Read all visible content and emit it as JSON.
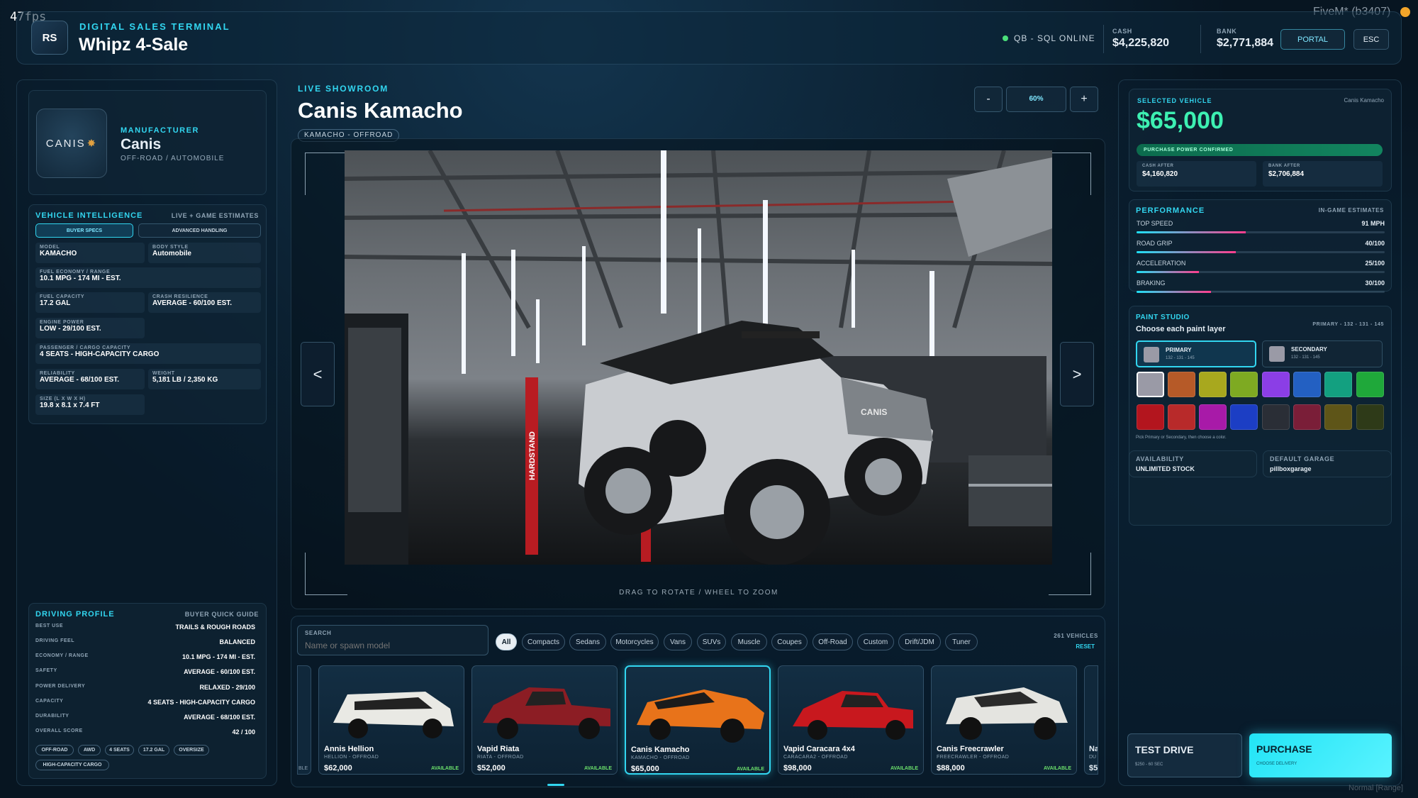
{
  "overlay": {
    "fps": "47fps",
    "fivem": "FiveM* (b3407)",
    "corner": "Normal [Range]"
  },
  "header": {
    "logo": "RS",
    "subtitle": "DIGITAL SALES TERMINAL",
    "title": "Whipz 4-Sale",
    "status": "QB - SQL ONLINE",
    "cash_label": "CASH",
    "cash": "$4,225,820",
    "bank_label": "BANK",
    "bank": "$2,771,884",
    "portal": "PORTAL",
    "esc": "ESC"
  },
  "manufacturer": {
    "logo_text": "CANIS",
    "label": "MANUFACTURER",
    "name": "Canis",
    "category": "OFF-ROAD / AUTOMOBILE"
  },
  "intel": {
    "title": "VEHICLE INTELLIGENCE",
    "hint": "LIVE + GAME ESTIMATES",
    "tab_buyer": "BUYER SPECS",
    "tab_handling": "ADVANCED HANDLING",
    "model_label": "MODEL",
    "model": "KAMACHO",
    "body_label": "BODY STYLE",
    "body": "Automobile",
    "fuel_label": "FUEL ECONOMY / RANGE",
    "fuel": "10.1 MPG - 174 MI - EST.",
    "capacity_label": "FUEL CAPACITY",
    "capacity": "17.2 GAL",
    "crash_label": "CRASH RESILIENCE",
    "crash": "AVERAGE - 60/100 EST.",
    "power_label": "ENGINE POWER",
    "power": "LOW - 29/100 EST.",
    "pass_label": "PASSENGER / CARGO CAPACITY",
    "pass": "4 SEATS - HIGH-CAPACITY CARGO",
    "rel_label": "RELIABILITY",
    "rel": "AVERAGE - 68/100 EST.",
    "weight_label": "WEIGHT",
    "weight": "5,181 LB / 2,350 KG",
    "size_label": "SIZE (L x W x H)",
    "size": "19.8 x 8.1 x 7.4 FT"
  },
  "profile": {
    "title": "DRIVING PROFILE",
    "hint": "BUYER QUICK GUIDE",
    "rows": [
      {
        "k": "BEST USE",
        "v": "TRAILS & ROUGH ROADS"
      },
      {
        "k": "DRIVING FEEL",
        "v": "BALANCED"
      },
      {
        "k": "ECONOMY / RANGE",
        "v": "10.1 MPG - 174 MI - EST."
      },
      {
        "k": "SAFETY",
        "v": "AVERAGE - 60/100 EST."
      },
      {
        "k": "POWER DELIVERY",
        "v": "RELAXED - 29/100"
      },
      {
        "k": "CAPACITY",
        "v": "4 SEATS - HIGH-CAPACITY CARGO"
      },
      {
        "k": "DURABILITY",
        "v": "AVERAGE - 68/100 EST."
      },
      {
        "k": "OVERALL SCORE",
        "v": "42 / 100"
      }
    ],
    "tags": [
      "OFF-ROAD",
      "AWD",
      "4 SEATS",
      "17.2 GAL",
      "OVERSIZE",
      "HIGH-CAPACITY CARGO"
    ]
  },
  "showroom": {
    "label": "LIVE SHOWROOM",
    "title": "Canis Kamacho",
    "badge": "KAMACHO - OFFROAD",
    "zoom_minus": "-",
    "zoom": "60%",
    "zoom_plus": "+",
    "hint": "DRAG TO ROTATE / WHEEL TO ZOOM",
    "prev": "<",
    "next": ">",
    "scene_sign": "CANIS",
    "lift_text": "HARDSTAND"
  },
  "search": {
    "label": "SEARCH",
    "placeholder": "Name or spawn model",
    "count": "261 VEHICLES",
    "reset": "RESET",
    "filters": [
      "All",
      "Compacts",
      "Sedans",
      "Motorcycles",
      "Vans",
      "SUVs",
      "Muscle",
      "Coupes",
      "Off-Road",
      "Custom",
      "Drift/JDM",
      "Tuner"
    ]
  },
  "cards": [
    {
      "name": "Annis Hellion",
      "sub": "HELLION - OFFROAD",
      "price": "$62,000",
      "avail": "AVAILABLE",
      "color": "#e9e9e4"
    },
    {
      "name": "Vapid Riata",
      "sub": "RIATA - OFFROAD",
      "price": "$52,000",
      "avail": "AVAILABLE",
      "color": "#8c1d24"
    },
    {
      "name": "Canis Kamacho",
      "sub": "KAMACHO - OFFROAD",
      "price": "$65,000",
      "avail": "AVAILABLE",
      "color": "#e8731a"
    },
    {
      "name": "Vapid Caracara 4x4",
      "sub": "CARACARA2 - OFFROAD",
      "price": "$98,000",
      "avail": "AVAILABLE",
      "color": "#c8181e"
    },
    {
      "name": "Canis Freecrawler",
      "sub": "FREECRAWLER - OFFROAD",
      "price": "$88,000",
      "avail": "AVAILABLE",
      "color": "#e4e4e0"
    }
  ],
  "card_edges": {
    "left_sub": "BLE",
    "right_name": "Na",
    "right_sub": "DU",
    "right_price": "$5"
  },
  "selected": {
    "label": "SELECTED VEHICLE",
    "name": "Canis Kamacho",
    "price": "$65,000",
    "power": "PURCHASE POWER CONFIRMED",
    "cash_after_label": "CASH AFTER",
    "cash_after": "$4,160,820",
    "bank_after_label": "BANK AFTER",
    "bank_after": "$2,706,884"
  },
  "performance": {
    "title": "PERFORMANCE",
    "hint": "IN-GAME ESTIMATES",
    "stats": [
      {
        "k": "TOP SPEED",
        "v": "91 MPH",
        "pct": 0.44
      },
      {
        "k": "ROAD GRIP",
        "v": "40/100",
        "pct": 0.4
      },
      {
        "k": "ACCELERATION",
        "v": "25/100",
        "pct": 0.25
      },
      {
        "k": "BRAKING",
        "v": "30/100",
        "pct": 0.3
      }
    ]
  },
  "paint": {
    "title": "PAINT STUDIO",
    "prompt": "Choose each paint layer",
    "current": "PRIMARY - 132 - 131 - 145",
    "primary": "PRIMARY",
    "primary_code": "132 - 131 - 145",
    "secondary": "SECONDARY",
    "secondary_code": "132 - 131 - 145",
    "hint": "Pick Primary or Secondary, then choose a color.",
    "swatches": [
      "#9a9aa6",
      "#b65a28",
      "#a8a81e",
      "#7eaa22",
      "#8b3ee6",
      "#2360c2",
      "#13a080",
      "#1fa83a",
      "#b3151e",
      "#b82a2a",
      "#a81aa8",
      "#1c3ec4",
      "#2a2e36",
      "#7a1e38",
      "#5e5518",
      "#2e3a18"
    ]
  },
  "availability": {
    "label": "AVAILABILITY",
    "value": "UNLIMITED STOCK",
    "garage_label": "DEFAULT GARAGE",
    "garage": "pillboxgarage"
  },
  "actions": {
    "test": "TEST DRIVE",
    "test_sub": "$250 - 60 SEC",
    "buy": "PURCHASE",
    "buy_sub": "CHOOSE DELIVERY"
  }
}
